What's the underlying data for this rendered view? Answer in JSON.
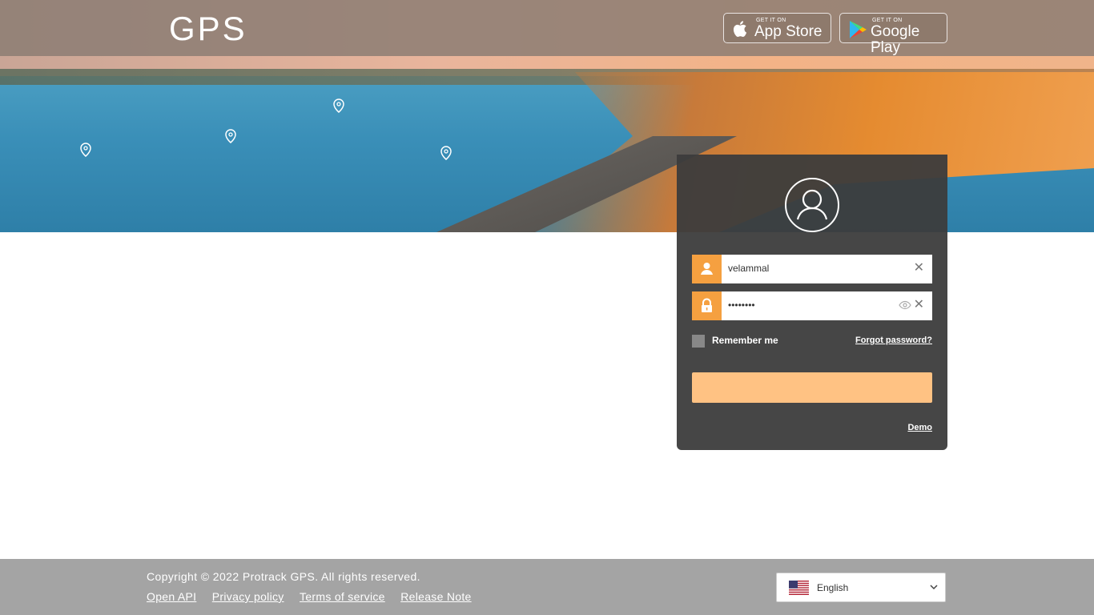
{
  "brand": {
    "logo_text": "GPS"
  },
  "stores": {
    "apple": {
      "small": "GET IT ON",
      "big": "App Store"
    },
    "google": {
      "small": "GET IT ON",
      "big": "Google Play"
    }
  },
  "login": {
    "username": {
      "value": "velammal"
    },
    "password": {
      "value": "••••••••"
    },
    "remember_label": "Remember me",
    "forgot_label": "Forgot password?",
    "login_button_label": "",
    "demo_label": "Demo"
  },
  "footer": {
    "copyright": "Copyright © 2022 Protrack GPS. All rights reserved.",
    "links": [
      "Open API",
      "Privacy policy",
      "Terms of service",
      "Release Note"
    ],
    "language": "English"
  },
  "colors": {
    "accent": "#f5a040",
    "login_button": "#ffc283",
    "panel": "#3c3c3c",
    "footer": "#a4a4a4"
  }
}
